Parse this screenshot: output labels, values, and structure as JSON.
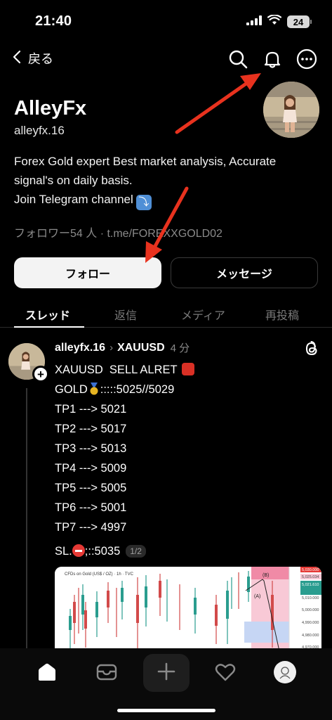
{
  "status_bar": {
    "time": "21:40",
    "battery": "24"
  },
  "nav": {
    "back_label": "戻る"
  },
  "profile": {
    "name": "AlleyFx",
    "handle": "alleyfx.16",
    "bio_line1": "Forex Gold expert Best market analysis, Accurate",
    "bio_line2": "signal's on daily basis.",
    "bio_line3": "Join Telegram channel",
    "telegram_emoji": "⤵",
    "followers_text": "フォロワー54 人 · t.me/FOREXXGOLD02"
  },
  "actions": {
    "follow_label": "フォロー",
    "message_label": "メッセージ"
  },
  "tabs": [
    {
      "label": "スレッド",
      "active": true
    },
    {
      "label": "返信",
      "active": false
    },
    {
      "label": "メディア",
      "active": false
    },
    {
      "label": "再投稿",
      "active": false
    }
  ],
  "post": {
    "username": "alleyfx.16",
    "topic": "XAUUSD",
    "time": "4 分",
    "lines": [
      "XAUUSD  SELL ALRET",
      "GOLD",
      "TP1 ---> 5021",
      "TP2 ---> 5017",
      "TP3 ---> 5013",
      "TP4 ---> 5009",
      "TP5 ---> 5005",
      "TP6 ---> 5001",
      "TP7 ---> 4997"
    ],
    "gold_suffix": ":::::5025//5029",
    "sl_prefix": "SL.",
    "sl_value": ";::5035",
    "media_page": "1/2",
    "chart_title": "CFDs on Gold (US$ / OZ) · 1h · TVC",
    "chart_labels": [
      "(B)",
      "(A)"
    ],
    "chart_prices": [
      "5,030.000",
      "5,025.034",
      "5,021.610",
      "5,010.000",
      "5,000.000",
      "4,990.000",
      "4,980.000",
      "4,970.000"
    ]
  },
  "colors": {
    "accent_red": "#e53935",
    "background": "#000000"
  }
}
